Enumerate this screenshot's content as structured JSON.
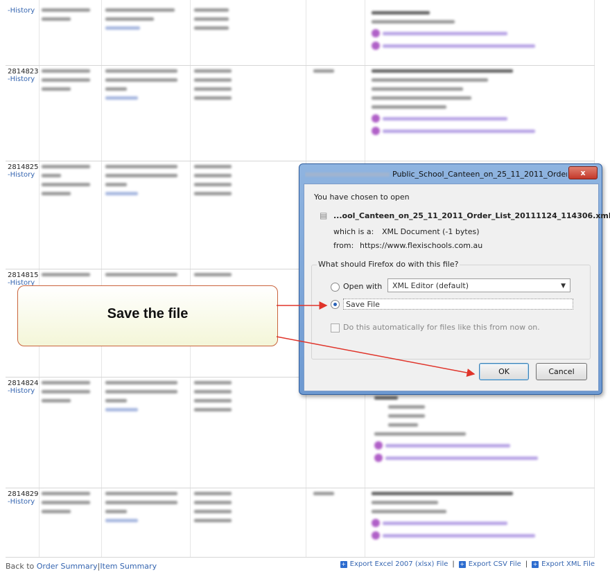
{
  "orders": [
    {
      "id": "",
      "history": "-History"
    },
    {
      "id": "2814823",
      "history": "-History"
    },
    {
      "id": "2814825",
      "history": "-History"
    },
    {
      "id": "2814815",
      "history": "-History"
    },
    {
      "id": "2814824",
      "history": "-History"
    },
    {
      "id": "2814829",
      "history": "-History"
    }
  ],
  "footer": {
    "back_to": "Back to",
    "order_summary": "Order Summary",
    "sep": "|",
    "item_summary": "Item Summary",
    "export_excel": "Export Excel 2007 (xlsx) File",
    "export_csv": "Export CSV File",
    "export_xml": "Export XML File",
    "export_sep": "|"
  },
  "dialog": {
    "title": "Public_School_Canteen_on_25_11_2011_Order_...",
    "close": "x",
    "chosen": "You have chosen to open",
    "filename": "...ool_Canteen_on_25_11_2011_Order_List_20111124_114306.xml",
    "which_is_label": "which is a:",
    "which_is_value": "XML Document (-1 bytes)",
    "from_label": "from:",
    "from_value": "https://www.flexischools.com.au",
    "question": "What should Firefox do with this file?",
    "open_with": "Open with",
    "open_with_app": "XML Editor (default)",
    "save_file": "Save File",
    "auto": "Do this automatically for files like this from now on.",
    "ok": "OK",
    "cancel": "Cancel"
  },
  "callout": {
    "text": "Save the file"
  },
  "colors": {
    "accent_arrow": "#e0342a",
    "dialog_frame": "#6d99d1",
    "link": "#3565b0"
  }
}
